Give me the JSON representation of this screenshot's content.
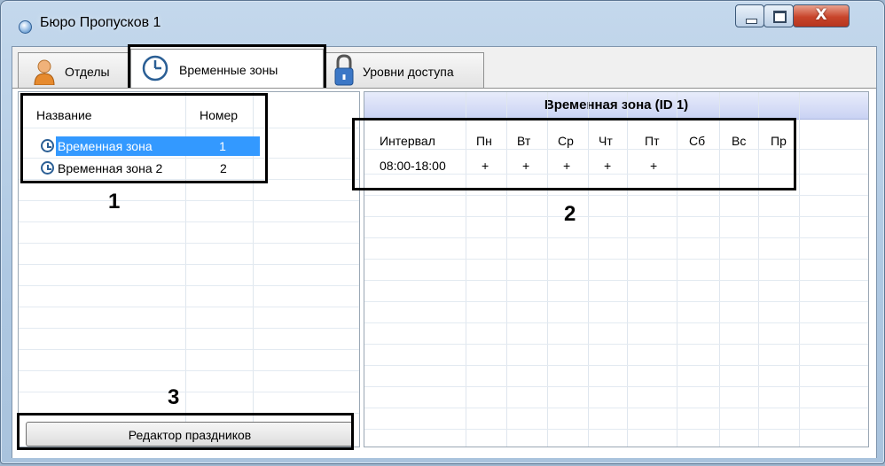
{
  "window": {
    "title": "Бюро Пропусков 1",
    "close_glyph": "X"
  },
  "tabs": [
    {
      "label": "Отделы",
      "icon": "person-icon"
    },
    {
      "label": "Временные зоны",
      "icon": "clock-icon",
      "active": true
    },
    {
      "label": "Уровни доступа",
      "icon": "padlock-icon"
    }
  ],
  "zones_list": {
    "headers": [
      "Название",
      "Номер"
    ],
    "rows": [
      {
        "name": "Временная зона",
        "number": "1",
        "selected": true
      },
      {
        "name": "Временная зона 2",
        "number": "2"
      }
    ]
  },
  "zone_detail": {
    "title": "Временная зона (ID 1)",
    "headers": [
      "Интервал",
      "Пн",
      "Вт",
      "Ср",
      "Чт",
      "Пт",
      "Сб",
      "Вс",
      "Пр"
    ],
    "row": [
      "08:00-18:00",
      "+",
      "+",
      "+",
      "+",
      "+",
      "",
      "",
      ""
    ]
  },
  "holidays_button": "Редактор праздников",
  "callouts": [
    "1",
    "2",
    "3"
  ],
  "colors": {
    "selection": "#3399ff",
    "title_band": "#c9d2f3"
  }
}
